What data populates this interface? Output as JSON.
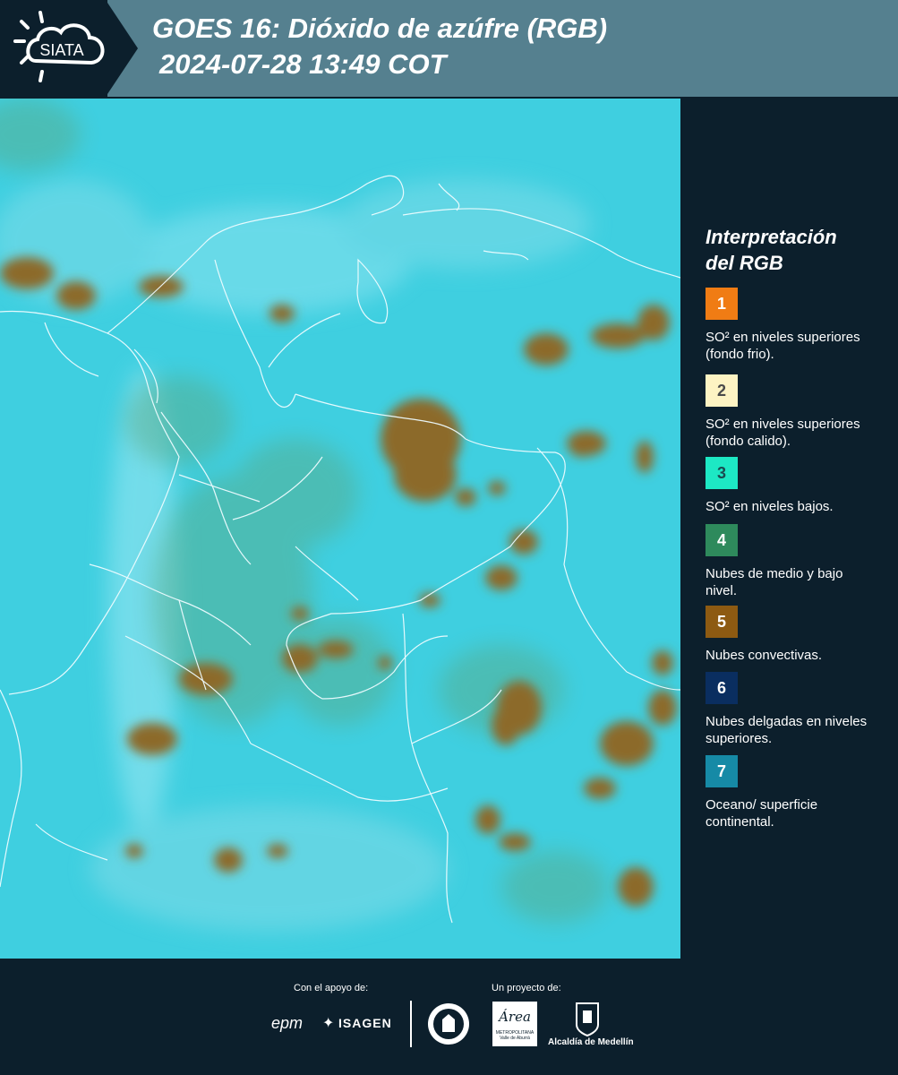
{
  "header": {
    "logo_text": "SIATA",
    "title": "GOES 16: Dióxido de azúfre (RGB)",
    "datetime": "2024-07-28 13:49 COT"
  },
  "legend": {
    "title_line1": "Interpretación",
    "title_line2": "del RGB",
    "items": [
      {
        "number": "1",
        "label": "SO² en niveles superiores (fondo frio).",
        "color": "#f07c14",
        "number_color": "#ffffff"
      },
      {
        "number": "2",
        "label": "SO² en niveles superiores (fondo calido).",
        "color": "#fdf3c3",
        "number_color": "#4a4a4a"
      },
      {
        "number": "3",
        "label": "SO² en niveles bajos.",
        "color": "#1de8c4",
        "number_color": "#1b4a50"
      },
      {
        "number": "4",
        "label": "Nubes de medio y bajo nivel.",
        "color": "#2e8a5c",
        "number_color": "#ffffff"
      },
      {
        "number": "5",
        "label": "Nubes convectivas.",
        "color": "#8d5a12",
        "number_color": "#ffffff"
      },
      {
        "number": "6",
        "label": "Nubes delgadas en niveles superiores.",
        "color": "#0a2e60",
        "number_color": "#ffffff"
      },
      {
        "number": "7",
        "label": "Oceano/ superficie continental.",
        "color": "#168aa6",
        "number_color": "#ffffff"
      }
    ]
  },
  "footer": {
    "support_label": "Con el apoyo de:",
    "project_label": "Un proyecto de:",
    "sponsor_epm": "epm",
    "sponsor_isagen": "ISAGEN",
    "area_logo_text": "Área",
    "area_sub1": "METROPOLITANA",
    "area_sub2": "Valle de Aburrá",
    "alcaldia": "Alcaldía de Medellín"
  }
}
